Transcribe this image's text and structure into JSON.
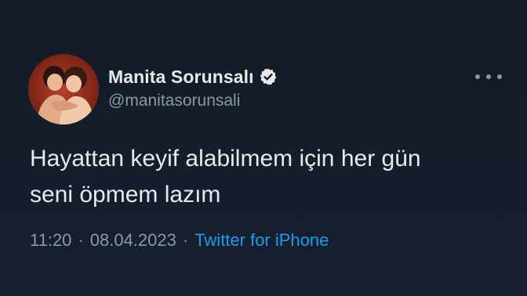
{
  "tweet": {
    "display_name": "Manita Sorunsalı",
    "handle": "@manitasorunsali",
    "text_line1": "Hayattan keyif alabilmem için her gün",
    "text_line2": "seni öpmem lazım",
    "time": "11:20",
    "date": "08.04.2023",
    "separator": "·",
    "source": "Twitter for iPhone"
  },
  "icons": {
    "verified": "verified-badge-icon",
    "more": "more-options-icon"
  },
  "colors": {
    "background": "#151d29",
    "text_primary": "#e7e9ea",
    "text_secondary": "#8b98a5",
    "link": "#1d9bf0"
  }
}
